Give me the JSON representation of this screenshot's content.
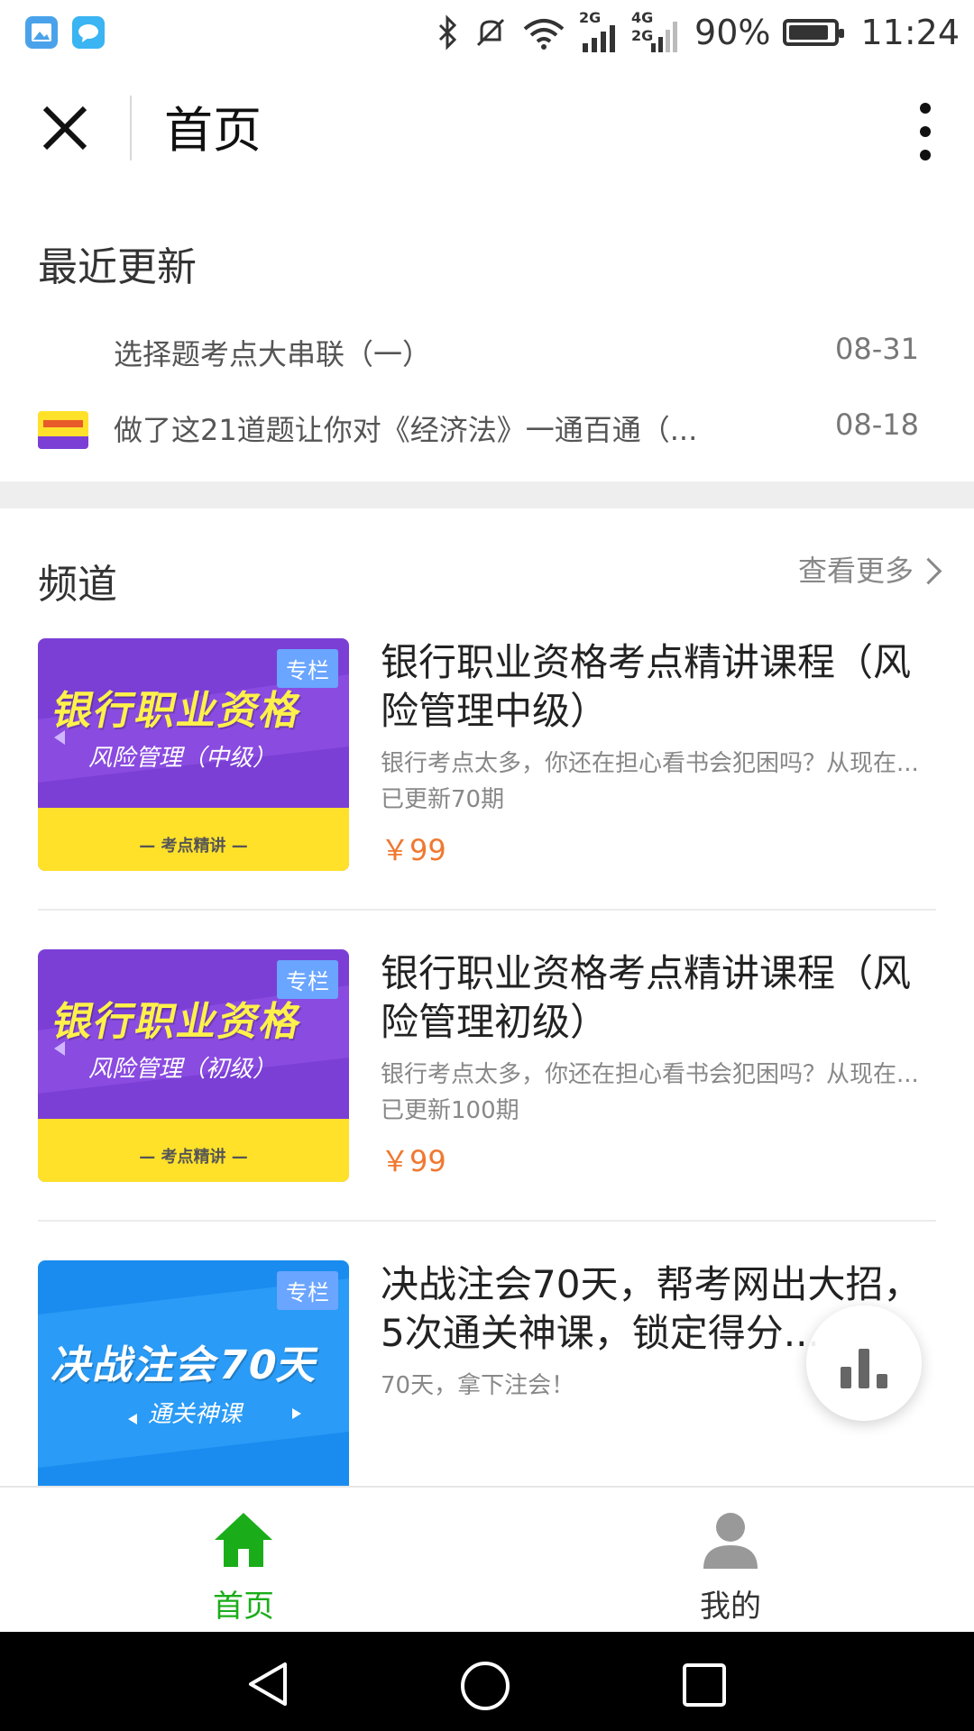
{
  "status_bar": {
    "network_1": "2G",
    "network_2": "4G",
    "network_3": "2G",
    "battery": "90%",
    "battery_level": 0.9,
    "time": "11:24",
    "icons": [
      "gallery-icon",
      "message-icon",
      "bluetooth-icon",
      "mute-icon",
      "wifi-icon",
      "signal-icon"
    ]
  },
  "nav": {
    "title": "首页"
  },
  "recent": {
    "title": "最近更新",
    "items": [
      {
        "title": "选择题考点大串联（一）",
        "date": "08-31"
      },
      {
        "title": "做了这21道题让你对《经济法》一通百通（...",
        "date": "08-18"
      }
    ]
  },
  "channel": {
    "title": "频道",
    "see_more": "查看更多",
    "cards": [
      {
        "badge": "专栏",
        "title": "银行职业资格考点精讲课程（风险管理中级）",
        "desc": "银行考点太多，你还在担心看书会犯困吗？从现在...",
        "count": "已更新70期",
        "price": "￥99",
        "cover_big": "银行职业资格",
        "cover_sub": "风险管理（中级）",
        "cover_band": "— 考点精讲 —"
      },
      {
        "badge": "专栏",
        "title": "银行职业资格考点精讲课程（风险管理初级）",
        "desc": "银行考点太多，你还在担心看书会犯困吗？从现在...",
        "count": "已更新100期",
        "price": "￥99",
        "cover_big": "银行职业资格",
        "cover_sub": "风险管理（初级）",
        "cover_band": "— 考点精讲 —"
      },
      {
        "badge": "专栏",
        "title": "决战注会70天，帮考网出大招，5次通关神课，锁定得分...",
        "desc": "70天，拿下注会！",
        "cover_big": "决战注会70天",
        "cover_sub": "通关神课"
      }
    ]
  },
  "tabs": [
    {
      "label": "首页",
      "active": true
    },
    {
      "label": "我的",
      "active": false
    }
  ],
  "colors": {
    "accent_green": "#1aad19",
    "price_orange": "#f07830",
    "purple_cover": "#7b3fd6",
    "blue_cover": "#1a8cf0"
  }
}
